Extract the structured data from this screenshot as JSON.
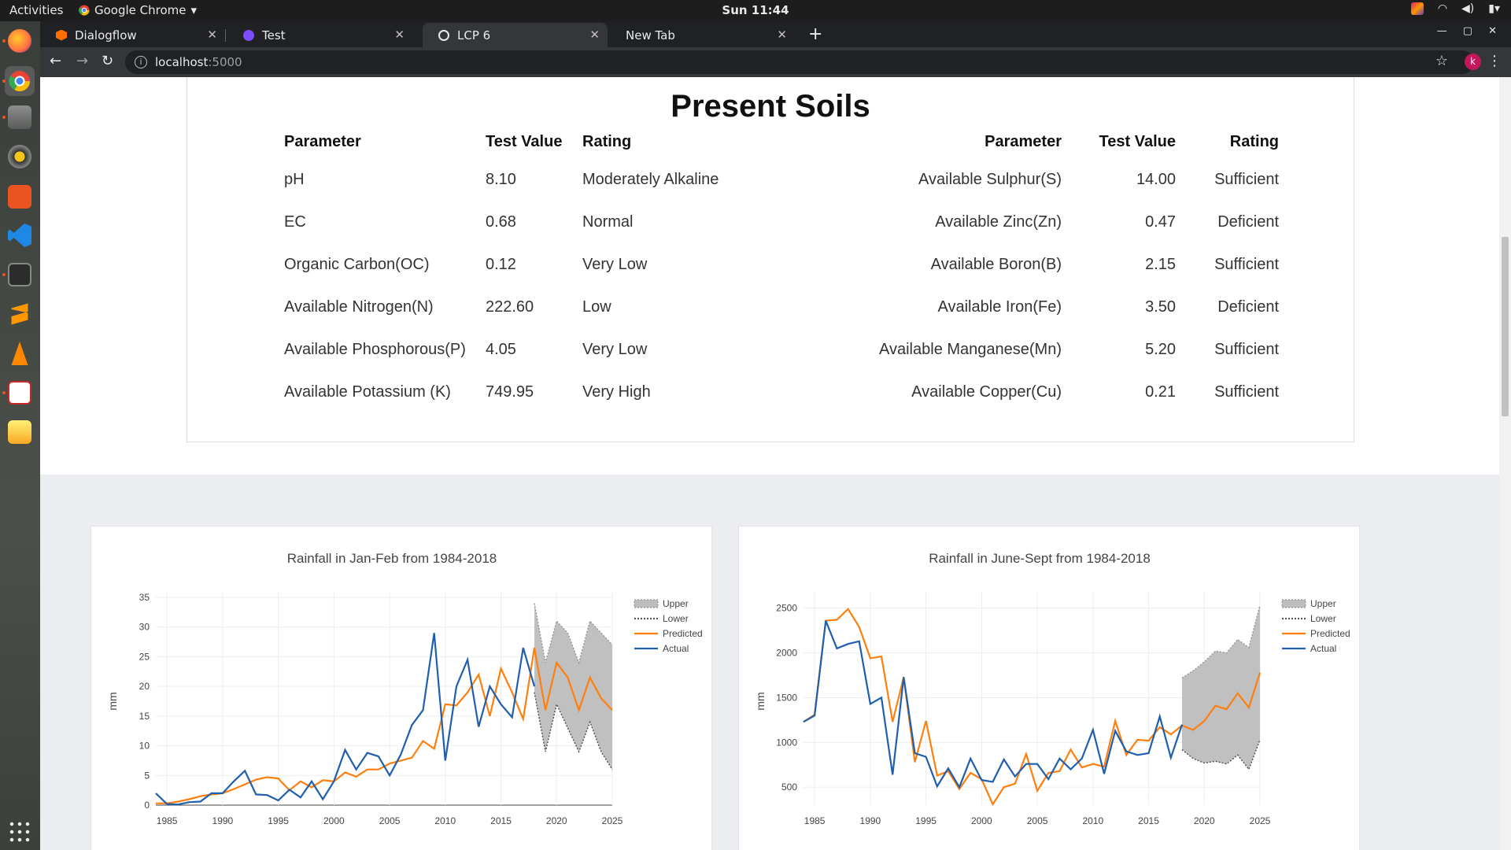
{
  "topbar": {
    "activities": "Activities",
    "app_name": "Google Chrome",
    "clock": "Sun 11:44"
  },
  "dock": {
    "icons": [
      "firefox-icon",
      "chrome-icon",
      "files-icon",
      "rhythmbox-icon",
      "software-icon",
      "vscode-icon",
      "terminal-icon",
      "sublime-icon",
      "vlc-icon",
      "libreoffice-impress-icon",
      "text-editor-icon",
      "apps-grid-icon"
    ]
  },
  "browser": {
    "tabs": [
      {
        "label": "Dialogflow",
        "color": "#ff6d00"
      },
      {
        "label": "Test",
        "color": "#7c4dff"
      },
      {
        "label": "LCP 6",
        "color": "#e8eaed"
      },
      {
        "label": "New Tab",
        "color": ""
      }
    ],
    "url_host": "localhost",
    "url_port": ":5000",
    "avatar_letter": "k"
  },
  "soils": {
    "title": "Present Soils",
    "headers": {
      "parameter": "Parameter",
      "test_value": "Test Value",
      "rating": "Rating"
    },
    "left_rows": [
      {
        "parameter": "pH",
        "value": "8.10",
        "rating": "Moderately Alkaline"
      },
      {
        "parameter": "EC",
        "value": "0.68",
        "rating": "Normal"
      },
      {
        "parameter": "Organic Carbon(OC)",
        "value": "0.12",
        "rating": "Very Low"
      },
      {
        "parameter": "Available Nitrogen(N)",
        "value": "222.60",
        "rating": "Low"
      },
      {
        "parameter": "Available Phosphorous(P)",
        "value": "4.05",
        "rating": "Very Low"
      },
      {
        "parameter": "Available Potassium (K)",
        "value": "749.95",
        "rating": "Very High"
      }
    ],
    "right_rows": [
      {
        "parameter": "Available Sulphur(S)",
        "value": "14.00",
        "rating": "Sufficient"
      },
      {
        "parameter": "Available Zinc(Zn)",
        "value": "0.47",
        "rating": "Deficient"
      },
      {
        "parameter": "Available Boron(B)",
        "value": "2.15",
        "rating": "Sufficient"
      },
      {
        "parameter": "Available Iron(Fe)",
        "value": "3.50",
        "rating": "Deficient"
      },
      {
        "parameter": "Available Manganese(Mn)",
        "value": "5.20",
        "rating": "Sufficient"
      },
      {
        "parameter": "Available Copper(Cu)",
        "value": "0.21",
        "rating": "Sufficient"
      }
    ]
  },
  "chart_data": [
    {
      "type": "line",
      "title": "Rainfall in Jan-Feb from 1984-2018",
      "ylabel": "mm",
      "xlabel": "",
      "xlim": [
        1984,
        2025
      ],
      "ylim": [
        0,
        35
      ],
      "xticks": [
        1985,
        1990,
        1995,
        2000,
        2005,
        2010,
        2015,
        2020,
        2025
      ],
      "yticks": [
        0,
        5,
        10,
        15,
        20,
        25,
        30,
        35
      ],
      "legend": "top-right",
      "grid": true,
      "series": [
        {
          "name": "Upper",
          "color": "#999999",
          "x": [
            2018,
            2019,
            2020,
            2021,
            2022,
            2023,
            2024,
            2025
          ],
          "values": [
            34,
            24,
            31,
            29,
            24,
            31,
            29,
            27
          ]
        },
        {
          "name": "Lower",
          "color": "#555555",
          "x": [
            2018,
            2019,
            2020,
            2021,
            2022,
            2023,
            2024,
            2025
          ],
          "values": [
            19,
            9,
            17,
            13,
            9,
            14,
            9,
            6
          ]
        },
        {
          "name": "Predicted",
          "color": "#ff7f0e",
          "x": [
            1984,
            1985,
            1986,
            1987,
            1988,
            1989,
            1990,
            1991,
            1992,
            1993,
            1994,
            1995,
            1996,
            1997,
            1998,
            1999,
            2000,
            2001,
            2002,
            2003,
            2004,
            2005,
            2006,
            2007,
            2008,
            2009,
            2010,
            2011,
            2012,
            2013,
            2014,
            2015,
            2016,
            2017,
            2018,
            2019,
            2020,
            2021,
            2022,
            2023,
            2024,
            2025
          ],
          "values": [
            0.3,
            0.3,
            0.6,
            1,
            1.5,
            1.8,
            2,
            2.7,
            3.5,
            4.3,
            4.7,
            4.5,
            2.5,
            4,
            3,
            4.2,
            4,
            5.5,
            4.8,
            6,
            6,
            7,
            7.5,
            8,
            10.8,
            9.5,
            17,
            16.8,
            19,
            22,
            15,
            23,
            19,
            14.5,
            26.5,
            16,
            24,
            21.5,
            16,
            21.5,
            18,
            16
          ]
        },
        {
          "name": "Actual",
          "color": "#1f5fad",
          "x": [
            1984,
            1985,
            1986,
            1987,
            1988,
            1989,
            1990,
            1991,
            1992,
            1993,
            1994,
            1995,
            1996,
            1997,
            1998,
            1999,
            2000,
            2001,
            2002,
            2003,
            2004,
            2005,
            2006,
            2007,
            2008,
            2009,
            2010,
            2011,
            2012,
            2013,
            2014,
            2015,
            2016,
            2017,
            2018
          ],
          "values": [
            2,
            0.2,
            0.1,
            0.5,
            0.6,
            2,
            2,
            4,
            5.8,
            1.8,
            1.7,
            0.8,
            2.6,
            1.3,
            4,
            1,
            4,
            9.3,
            6,
            8.8,
            8.2,
            5,
            8.5,
            13.5,
            16,
            29,
            7.5,
            20,
            24.5,
            13.2,
            20,
            17,
            14.8,
            26.5,
            20
          ]
        }
      ]
    },
    {
      "type": "line",
      "title": "Rainfall in June-Sept from 1984-2018",
      "ylabel": "mm",
      "xlabel": "",
      "xlim": [
        1984,
        2025
      ],
      "ylim": [
        300,
        2620
      ],
      "xticks": [
        1985,
        1990,
        1995,
        2000,
        2005,
        2010,
        2015,
        2020,
        2025
      ],
      "yticks": [
        500,
        1000,
        1500,
        2000,
        2500
      ],
      "legend": "top-right",
      "grid": true,
      "series": [
        {
          "name": "Upper",
          "color": "#999999",
          "x": [
            2018,
            2019,
            2020,
            2021,
            2022,
            2023,
            2024,
            2025
          ],
          "values": [
            1720,
            1800,
            1900,
            2020,
            2000,
            2150,
            2060,
            2530
          ]
        },
        {
          "name": "Lower",
          "color": "#555555",
          "x": [
            2018,
            2019,
            2020,
            2021,
            2022,
            2023,
            2024,
            2025
          ],
          "values": [
            920,
            820,
            770,
            790,
            760,
            860,
            700,
            1030
          ]
        },
        {
          "name": "Predicted",
          "color": "#ff7f0e",
          "x": [
            1984,
            1985,
            1986,
            1987,
            1988,
            1989,
            1990,
            1991,
            1992,
            1993,
            1994,
            1995,
            1996,
            1997,
            1998,
            1999,
            2000,
            2001,
            2002,
            2003,
            2004,
            2005,
            2006,
            2007,
            2008,
            2009,
            2010,
            2011,
            2012,
            2013,
            2014,
            2015,
            2016,
            2017,
            2018,
            2019,
            2020,
            2021,
            2022,
            2023,
            2024,
            2025
          ],
          "values": [
            1230,
            1310,
            2360,
            2370,
            2490,
            2290,
            1940,
            1960,
            1230,
            1730,
            780,
            1240,
            630,
            680,
            480,
            660,
            590,
            310,
            500,
            540,
            870,
            460,
            660,
            680,
            920,
            720,
            760,
            730,
            1240,
            860,
            1030,
            1020,
            1170,
            1090,
            1190,
            1140,
            1240,
            1410,
            1370,
            1550,
            1390,
            1780
          ]
        },
        {
          "name": "Actual",
          "color": "#1f5fad",
          "x": [
            1984,
            1985,
            1986,
            1987,
            1988,
            1989,
            1990,
            1991,
            1992,
            1993,
            1994,
            1995,
            1996,
            1997,
            1998,
            1999,
            2000,
            2001,
            2002,
            2003,
            2004,
            2005,
            2006,
            2007,
            2008,
            2009,
            2010,
            2011,
            2012,
            2013,
            2014,
            2015,
            2016,
            2017,
            2018
          ],
          "values": [
            1230,
            1300,
            2360,
            2050,
            2100,
            2130,
            1430,
            1500,
            640,
            1730,
            880,
            840,
            510,
            710,
            500,
            820,
            580,
            560,
            810,
            620,
            760,
            760,
            590,
            820,
            700,
            820,
            1140,
            650,
            1130,
            900,
            860,
            880,
            1290,
            830,
            1200
          ]
        }
      ]
    }
  ]
}
